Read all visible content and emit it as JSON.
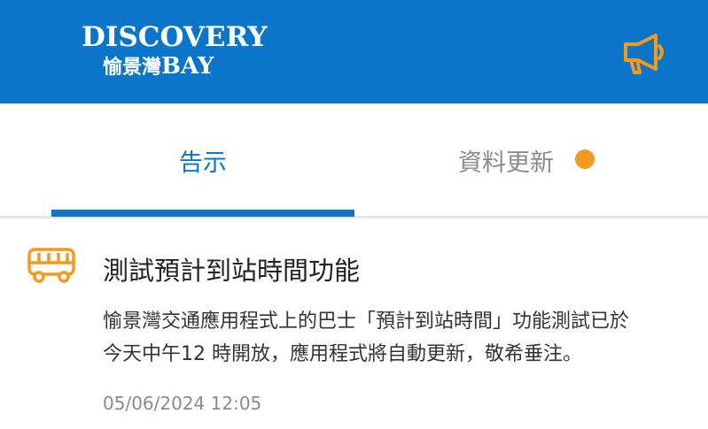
{
  "header": {
    "logo_top": "DISCOVERY",
    "logo_bottom_cn": "愉景灣",
    "logo_bottom_en": "BAY",
    "megaphone_icon": "megaphone-icon",
    "background": "#0b75c9",
    "icon_color": "#f39a1e"
  },
  "tabs": [
    {
      "label": "告示",
      "active": true
    },
    {
      "label": "資料更新",
      "active": false,
      "badge": "orange-dot"
    }
  ],
  "notice": {
    "icon": "bus-icon",
    "title": "測試預計到站時間功能",
    "body_line1": "愉景灣交通應用程式上的巴士「預計到站時間」功能測試已於",
    "body_line2": "今天中午12 時開放，應用程式將自動更新，敬希垂注。",
    "timestamp": "05/06/2024 12:05"
  }
}
